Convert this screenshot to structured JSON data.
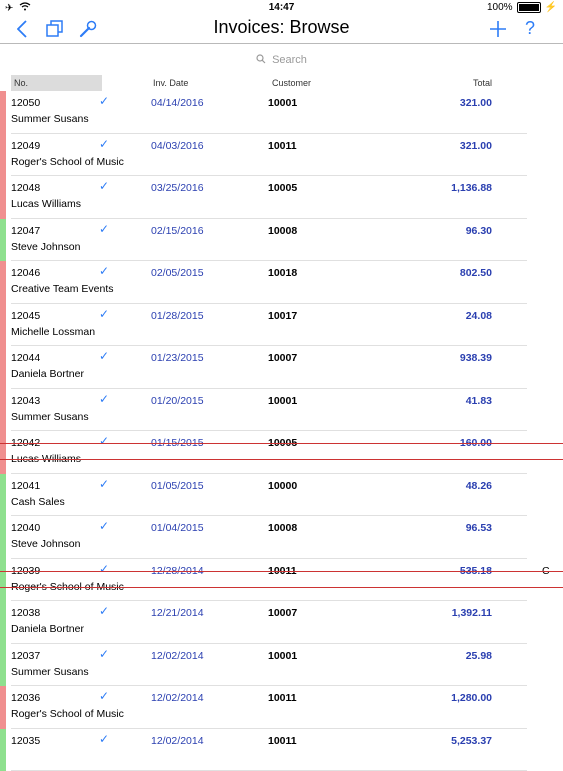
{
  "status": {
    "time": "14:47",
    "battery": "100%"
  },
  "nav": {
    "title": "Invoices: Browse"
  },
  "search": {
    "placeholder": "Search"
  },
  "header": {
    "no": "No.",
    "date": "Inv. Date",
    "customer": "Customer",
    "total": "Total"
  },
  "colors": {
    "accent": "#2d7cf6",
    "red": "#f08f8f",
    "green": "#8ee08e"
  },
  "rows": [
    {
      "no": "12050",
      "date": "04/14/2016",
      "customer": "10001",
      "total": "321.00",
      "name": "Summer Susans",
      "color": "red",
      "checked": true,
      "voided": false,
      "flag": ""
    },
    {
      "no": "12049",
      "date": "04/03/2016",
      "customer": "10011",
      "total": "321.00",
      "name": "Roger's School of Music",
      "color": "red",
      "checked": true,
      "voided": false,
      "flag": ""
    },
    {
      "no": "12048",
      "date": "03/25/2016",
      "customer": "10005",
      "total": "1,136.88",
      "name": "Lucas Williams",
      "color": "red",
      "checked": true,
      "voided": false,
      "flag": ""
    },
    {
      "no": "12047",
      "date": "02/15/2016",
      "customer": "10008",
      "total": "96.30",
      "name": "Steve Johnson",
      "color": "green",
      "checked": true,
      "voided": false,
      "flag": ""
    },
    {
      "no": "12046",
      "date": "02/05/2015",
      "customer": "10018",
      "total": "802.50",
      "name": "Creative Team Events",
      "color": "red",
      "checked": true,
      "voided": false,
      "flag": ""
    },
    {
      "no": "12045",
      "date": "01/28/2015",
      "customer": "10017",
      "total": "24.08",
      "name": "Michelle Lossman",
      "color": "red",
      "checked": true,
      "voided": false,
      "flag": ""
    },
    {
      "no": "12044",
      "date": "01/23/2015",
      "customer": "10007",
      "total": "938.39",
      "name": "Daniela Bortner",
      "color": "red",
      "checked": true,
      "voided": false,
      "flag": ""
    },
    {
      "no": "12043",
      "date": "01/20/2015",
      "customer": "10001",
      "total": "41.83",
      "name": "Summer Susans",
      "color": "red",
      "checked": true,
      "voided": false,
      "flag": ""
    },
    {
      "no": "12042",
      "date": "01/15/2015",
      "customer": "10005",
      "total": "160.00",
      "name": "Lucas Williams",
      "color": "red",
      "checked": true,
      "voided": true,
      "flag": ""
    },
    {
      "no": "12041",
      "date": "01/05/2015",
      "customer": "10000",
      "total": "48.26",
      "name": "Cash Sales",
      "color": "green",
      "checked": true,
      "voided": false,
      "flag": ""
    },
    {
      "no": "12040",
      "date": "01/04/2015",
      "customer": "10008",
      "total": "96.53",
      "name": "Steve Johnson",
      "color": "green",
      "checked": true,
      "voided": false,
      "flag": ""
    },
    {
      "no": "12039",
      "date": "12/28/2014",
      "customer": "10011",
      "total": "535.18",
      "name": "Roger's School of Music",
      "color": "green",
      "checked": true,
      "voided": true,
      "flag": "C"
    },
    {
      "no": "12038",
      "date": "12/21/2014",
      "customer": "10007",
      "total": "1,392.11",
      "name": "Daniela Bortner",
      "color": "green",
      "checked": true,
      "voided": false,
      "flag": ""
    },
    {
      "no": "12037",
      "date": "12/02/2014",
      "customer": "10001",
      "total": "25.98",
      "name": "Summer Susans",
      "color": "green",
      "checked": true,
      "voided": false,
      "flag": ""
    },
    {
      "no": "12036",
      "date": "12/02/2014",
      "customer": "10011",
      "total": "1,280.00",
      "name": "Roger's School of Music",
      "color": "red",
      "checked": true,
      "voided": false,
      "flag": ""
    },
    {
      "no": "12035",
      "date": "12/02/2014",
      "customer": "10011",
      "total": "5,253.37",
      "name": "",
      "color": "green",
      "checked": true,
      "voided": false,
      "flag": ""
    }
  ]
}
